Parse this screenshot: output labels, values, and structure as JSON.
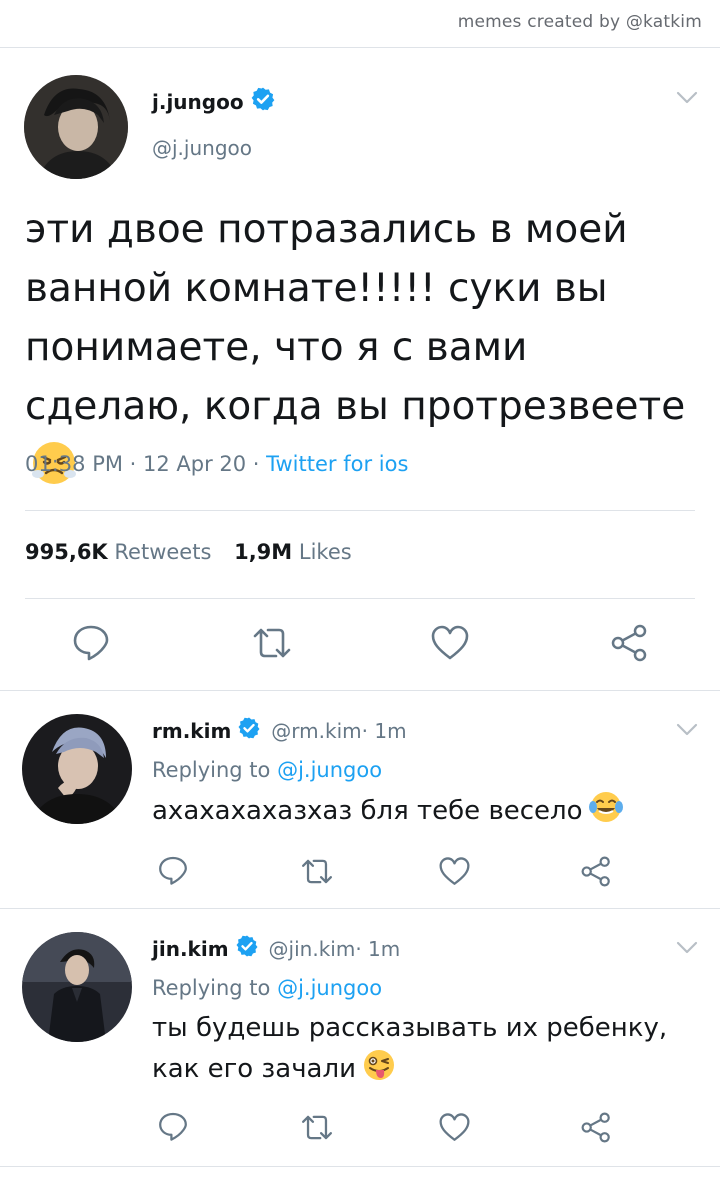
{
  "watermark": "memes created by @katkim",
  "main_tweet": {
    "name": "j.jungoo",
    "handle": "@j.jungoo",
    "text": "эти двое потразались в моей ванной комнате!!!!! суки вы понимаете, что я с вами сделаю, когда вы протрезвеете",
    "emoji": "steam-from-nose-face",
    "timestamp": "01:38 PM · 12 Apr 20 · ",
    "client": "Twitter for ios",
    "retweets_count": "995,6K",
    "retweets_label": "Retweets",
    "likes_count": "1,9M",
    "likes_label": "Likes"
  },
  "replies": [
    {
      "name": "rm.kim",
      "handle": "@rm.kim",
      "time": " · 1m",
      "replying_prefix": "Replying to ",
      "replying_to": "@j.jungoo",
      "text": "ахахахахазхаз бля тебе весело",
      "emoji": "tears-of-joy-face"
    },
    {
      "name": "jin.kim",
      "handle": "@jin.kim",
      "time": " · 1m",
      "replying_prefix": "Replying to ",
      "replying_to": "@j.jungoo",
      "text": "ты будешь рассказывать их ребенку, как его зачали",
      "emoji": "winking-tongue-face"
    }
  ],
  "colors": {
    "link": "#1da1f2",
    "muted": "#657786",
    "text": "#14171a",
    "divider": "#dfe3e8"
  }
}
